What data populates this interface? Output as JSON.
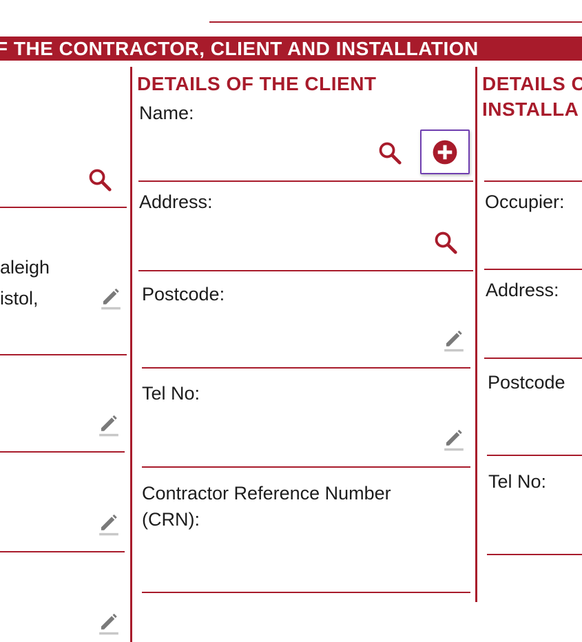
{
  "banner": {
    "title": "F THE CONTRACTOR, CLIENT AND INSTALLATION"
  },
  "left_column": {
    "address_partial": [
      "aleigh",
      "istol,"
    ]
  },
  "client": {
    "heading": "DETAILS OF THE CLIENT",
    "name_label": "Name:",
    "address_label": "Address:",
    "postcode_label": "Postcode:",
    "tel_label": "Tel No:",
    "crn_label_line1": "Contractor Reference Number",
    "crn_label_line2": "(CRN):"
  },
  "installation": {
    "heading_line1": "DETAILS C",
    "heading_line2": "INSTALLA",
    "occupier_label": "Occupier:",
    "address_label": "Address:",
    "postcode_label": "Postcode",
    "tel_label": "Tel No:"
  },
  "colors": {
    "accent": "#a81b2b",
    "highlight": "#6f3fb0",
    "icon_gray": "#7a7a7a"
  },
  "icons": [
    "search-icon",
    "add-icon",
    "edit-icon"
  ]
}
